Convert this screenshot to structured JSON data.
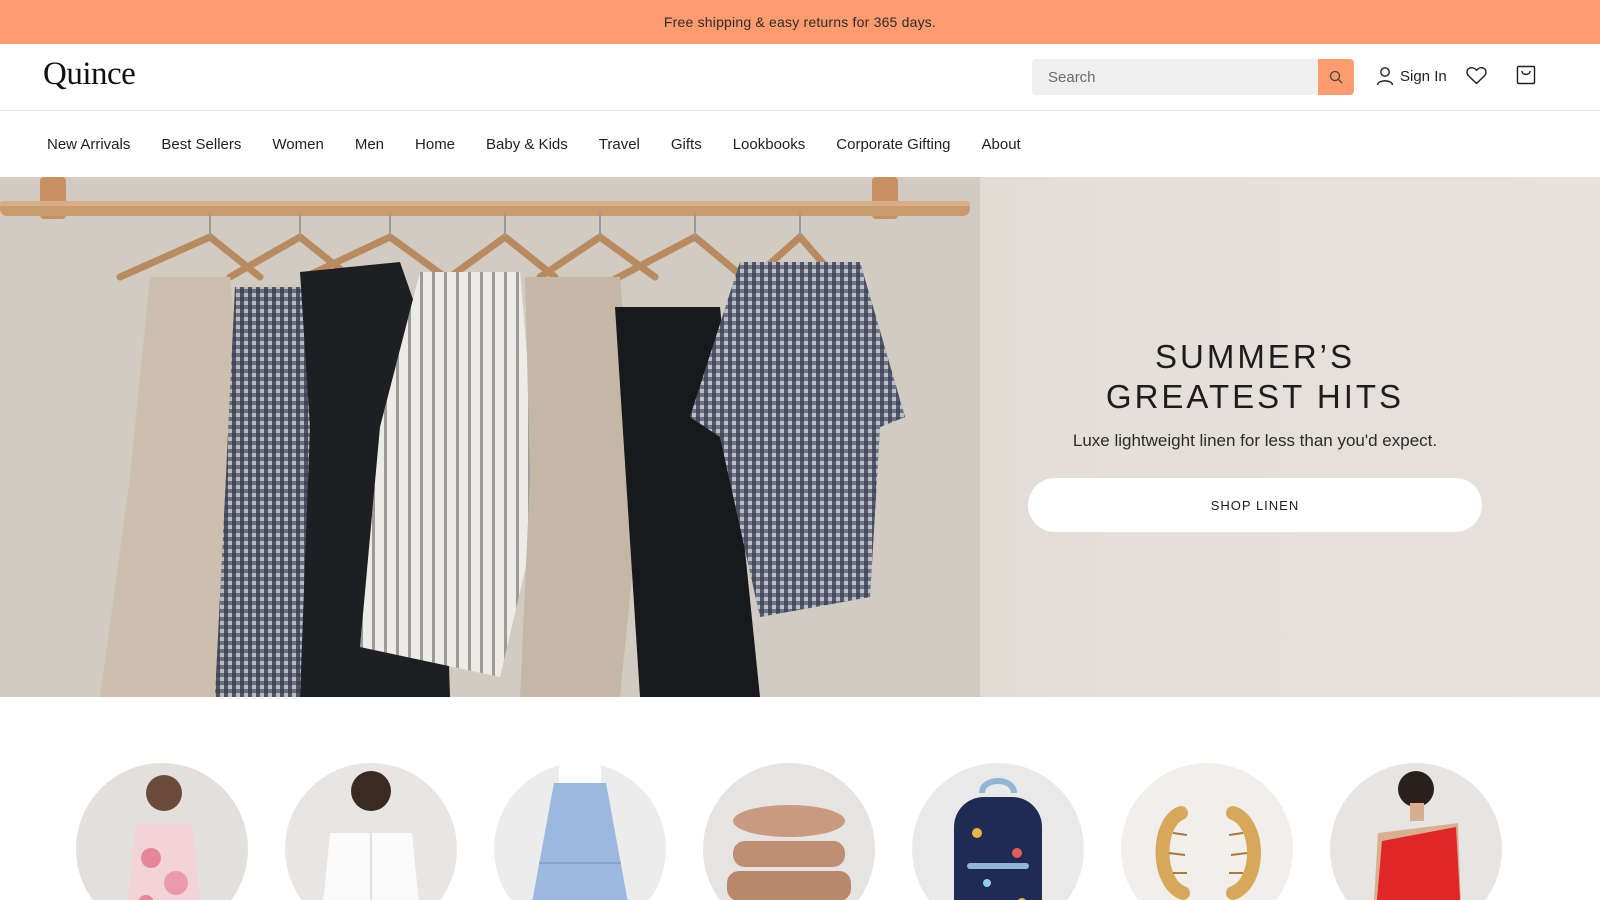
{
  "promo": {
    "text": "Free shipping & easy returns for 365 days."
  },
  "header": {
    "logo": "Quince",
    "search": {
      "placeholder": "Search",
      "value": ""
    },
    "signin_label": "Sign In"
  },
  "nav": {
    "items": [
      "New Arrivals",
      "Best Sellers",
      "Women",
      "Men",
      "Home",
      "Baby & Kids",
      "Travel",
      "Gifts",
      "Lookbooks",
      "Corporate Gifting",
      "About"
    ]
  },
  "hero": {
    "title_line1": "SUMMER’S",
    "title_line2": "GREATEST HITS",
    "subtitle": "Luxe lightweight linen for less than you'd expect.",
    "cta": "SHOP LINEN"
  },
  "colors": {
    "promo_bg": "#fe9b6f",
    "accent": "#fe9b6f"
  },
  "icons": [
    "search-icon",
    "user-icon",
    "heart-icon",
    "cart-icon"
  ]
}
